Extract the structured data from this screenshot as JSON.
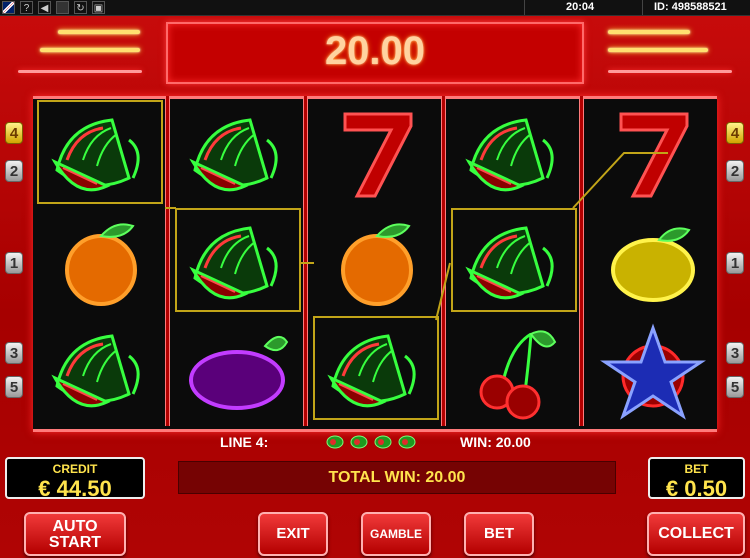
{
  "topbar": {
    "flag_icon": "uk-flag-icon",
    "help": "?",
    "time": "20:04",
    "id": "ID: 498588521"
  },
  "display": {
    "win_amount": "20.00"
  },
  "reels": [
    [
      "watermelon",
      "orange",
      "watermelon"
    ],
    [
      "watermelon",
      "watermelon",
      "plum"
    ],
    [
      "seven",
      "orange",
      "watermelon"
    ],
    [
      "watermelon",
      "watermelon",
      "cherries"
    ],
    [
      "seven",
      "lemon",
      "star"
    ]
  ],
  "win_line": {
    "line": 4,
    "highlighted": [
      [
        0,
        0
      ],
      [
        1,
        1
      ],
      [
        2,
        2
      ],
      [
        3,
        1
      ]
    ]
  },
  "line_markers": {
    "left": [
      "4",
      "2",
      "1",
      "3",
      "5"
    ],
    "right": [
      "4",
      "2",
      "1",
      "3",
      "5"
    ]
  },
  "info": {
    "line_label": "LINE 4:",
    "win_label": "WIN: 20.00",
    "total_win": "TOTAL WIN: 20.00"
  },
  "credit": {
    "label": "CREDIT",
    "value": "€ 44.50"
  },
  "bet": {
    "label": "BET",
    "value": "€ 0.50"
  },
  "buttons": {
    "auto_start_1": "AUTO",
    "auto_start_2": "START",
    "exit": "EXIT",
    "gamble": "GAMBLE",
    "bet": "BET",
    "collect": "COLLECT"
  },
  "colors": {
    "neon_green": "#2cff3a",
    "neon_red": "#ff2b2b",
    "highlight": "#c2a518",
    "accent_yellow": "#ffe44d"
  }
}
